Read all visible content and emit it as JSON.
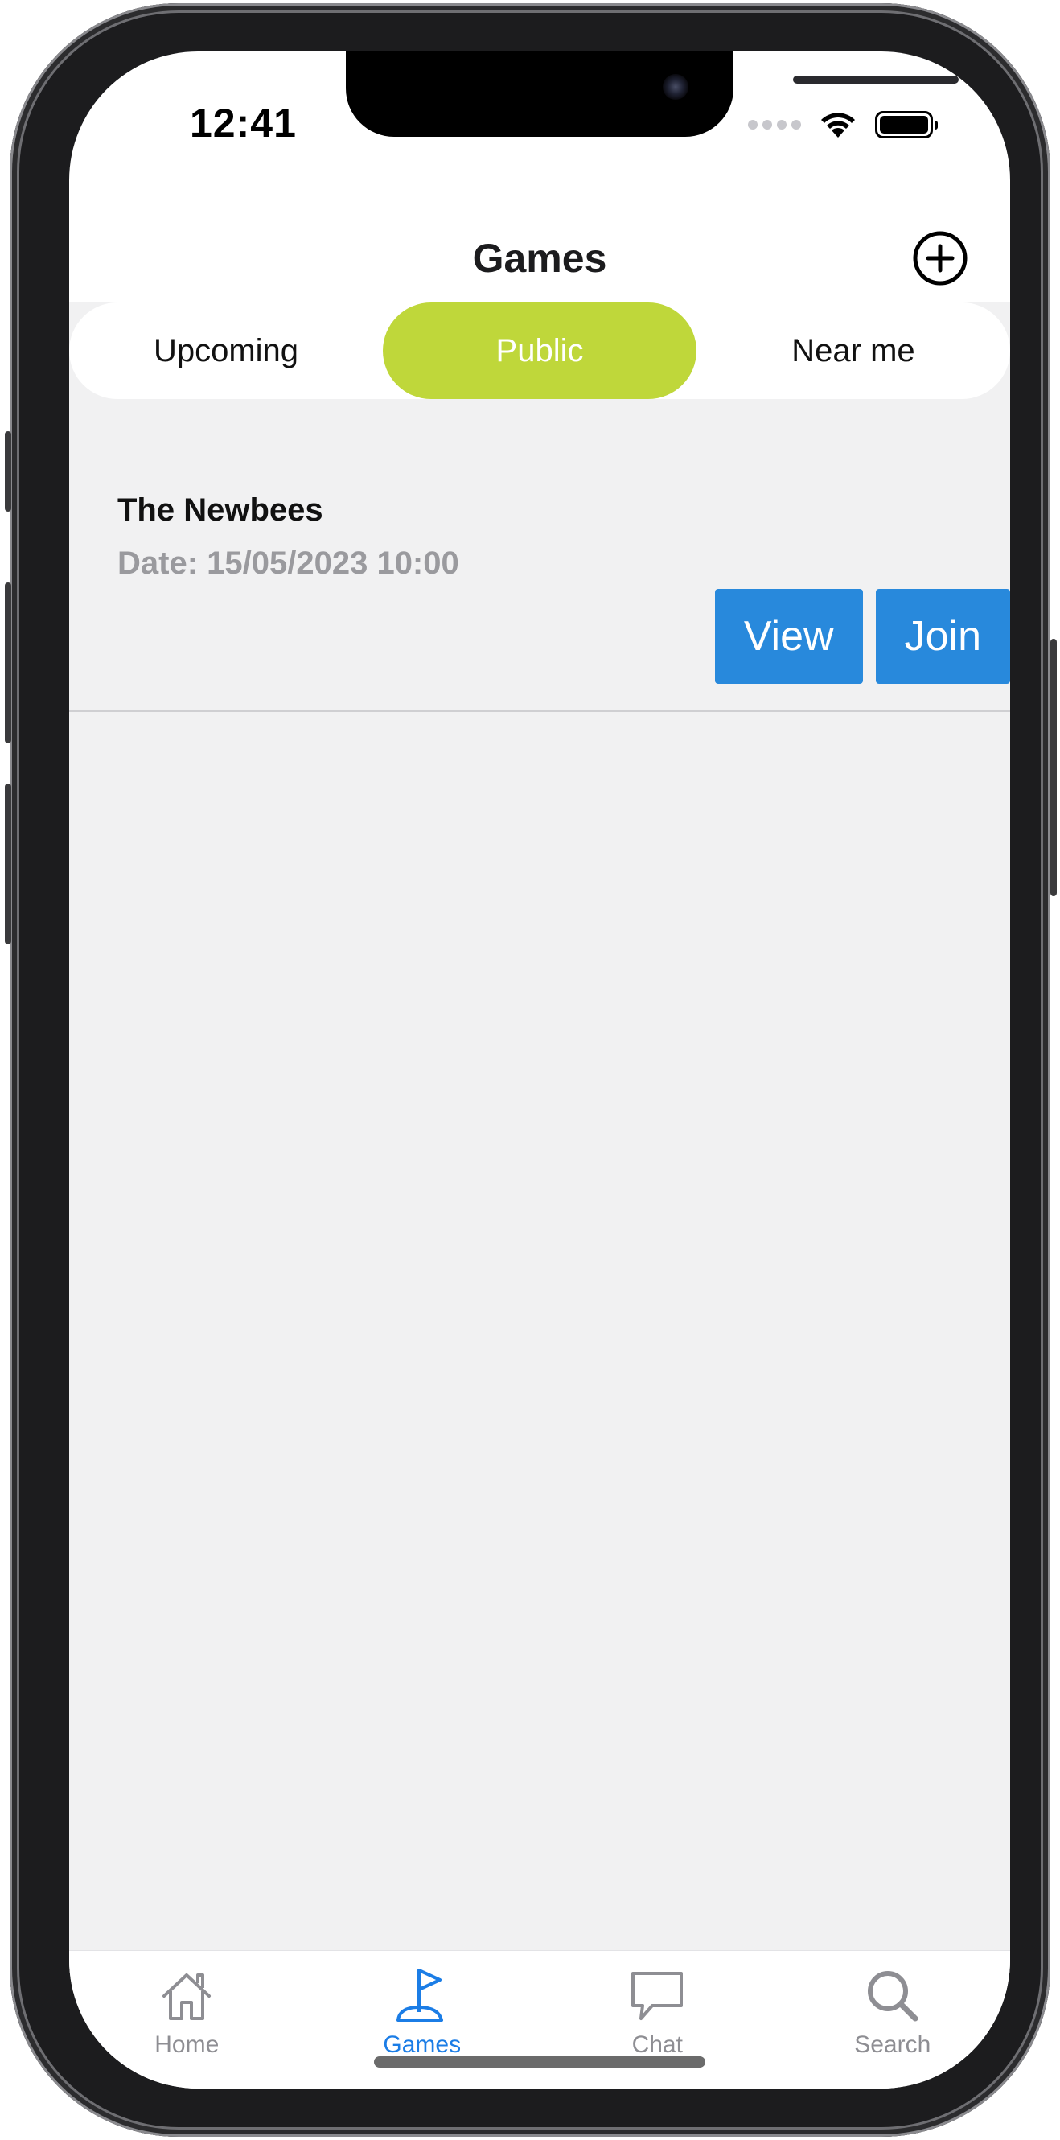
{
  "status_bar": {
    "time": "12:41"
  },
  "header": {
    "title": "Games",
    "add_icon": "plus-circle-icon"
  },
  "segments": {
    "items": [
      {
        "label": "Upcoming",
        "active": false
      },
      {
        "label": "Public",
        "active": true
      },
      {
        "label": "Near me",
        "active": false
      }
    ],
    "active_color": "#bfd73a"
  },
  "games": [
    {
      "name": "The Newbees",
      "date": "Date: 15/05/2023 10:00",
      "view_label": "View",
      "join_label": "Join"
    }
  ],
  "tabbar": {
    "items": [
      {
        "label": "Home",
        "icon": "home-icon",
        "active": false
      },
      {
        "label": "Games",
        "icon": "golf-flag-icon",
        "active": true
      },
      {
        "label": "Chat",
        "icon": "chat-bubble-icon",
        "active": false
      },
      {
        "label": "Search",
        "icon": "search-icon",
        "active": false
      }
    ],
    "active_color": "#1b7de6",
    "inactive_color": "#8e8e93"
  },
  "colors": {
    "button_blue": "#2889dc",
    "background": "#f1f1f2"
  }
}
